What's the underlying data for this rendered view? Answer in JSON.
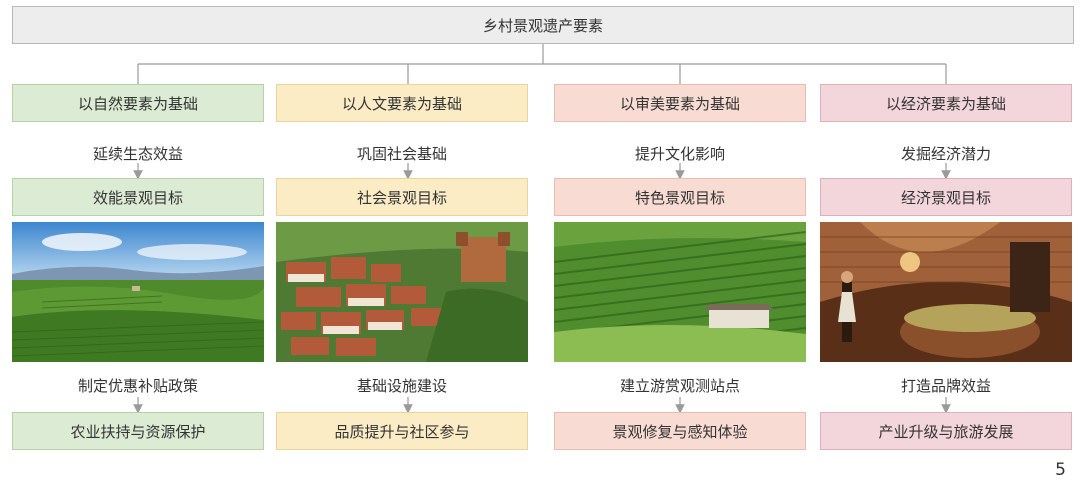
{
  "title": "乡村景观遗产要素",
  "columns": [
    {
      "basis": "以自然要素为基础",
      "driver": "延续生态效益",
      "target": "效能景观目标",
      "action": "制定优惠补贴政策",
      "outcome": "农业扶持与资源保护",
      "color": "#dcebd4"
    },
    {
      "basis": "以人文要素为基础",
      "driver": "巩固社会基础",
      "target": "社会景观目标",
      "action": "基础设施建设",
      "outcome": "品质提升与社区参与",
      "color": "#fbecc6"
    },
    {
      "basis": "以审美要素为基础",
      "driver": "提升文化影响",
      "target": "特色景观目标",
      "action": "建立游赏观测站点",
      "outcome": "景观修复与感知体验",
      "color": "#f8dcd3"
    },
    {
      "basis": "以经济要素为基础",
      "driver": "发掘经济潜力",
      "target": "经济景观目标",
      "action": "打造品牌效益",
      "outcome": "产业升级与旅游发展",
      "color": "#f3d6dc"
    }
  ],
  "page_number": "5"
}
